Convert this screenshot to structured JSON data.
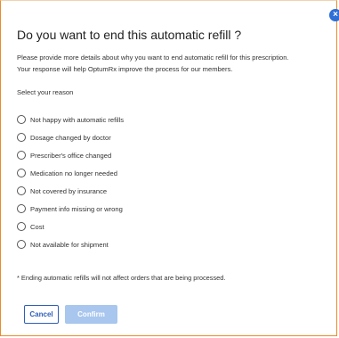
{
  "dialog": {
    "close_glyph": "×",
    "title": "Do you want to end this automatic refill ?",
    "intro_line1": "Please provide more details about why you want to end automatic refill for this prescription.",
    "intro_line2": "Your response will help OptumRx improve the process for our members.",
    "select_label": "Select your reason",
    "options": [
      "Not happy with automatic refills",
      "Dosage changed by doctor",
      "Prescriber's office changed",
      "Medication no longer needed",
      "Not covered by insurance",
      "Payment info missing or wrong",
      "Cost",
      "Not available for shipment"
    ],
    "footnote": "* Ending automatic refills will not affect orders that are being processed.",
    "cancel_label": "Cancel",
    "confirm_label": "Confirm"
  },
  "colors": {
    "accent_blue": "#2f5fb8",
    "confirm_disabled": "#a8c6ee",
    "close_blue": "#2f6fd6",
    "border_orange": "#e98b2a"
  },
  "icons": {
    "close": "close-icon",
    "radio": "radio-unchecked-icon"
  }
}
